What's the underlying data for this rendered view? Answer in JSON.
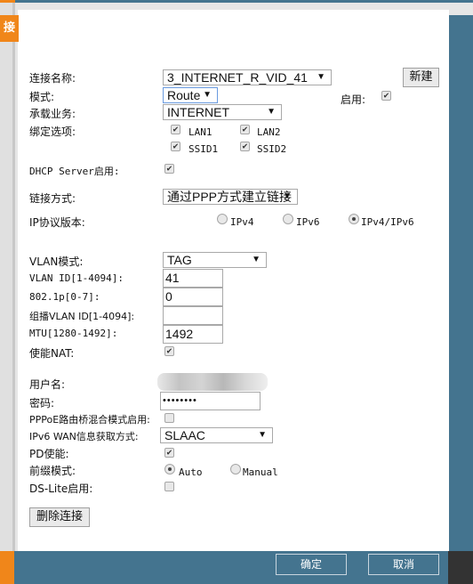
{
  "sidebar": {
    "tab_label": "接"
  },
  "form": {
    "conn_name": {
      "label": "连接名称:",
      "value": "3_INTERNET_R_VID_41"
    },
    "new_button": "新建",
    "mode": {
      "label": "模式:",
      "value": "Route"
    },
    "enable": {
      "label": "启用:",
      "checked": true
    },
    "service": {
      "label": "承载业务:",
      "value": "INTERNET"
    },
    "binding": {
      "label": "绑定选项:",
      "options": [
        {
          "label": "LAN1",
          "checked": true
        },
        {
          "label": "LAN2",
          "checked": true
        },
        {
          "label": "SSID1",
          "checked": true
        },
        {
          "label": "SSID2",
          "checked": true
        }
      ]
    },
    "dhcp": {
      "label": "DHCP Server启用:",
      "checked": true
    },
    "link_mode": {
      "label": "链接方式:",
      "value": "通过PPP方式建立链接"
    },
    "ip_version": {
      "label": "IP协议版本:",
      "options": [
        "IPv4",
        "IPv6",
        "IPv4/IPv6"
      ],
      "selected": "IPv4/IPv6"
    },
    "vlan_mode": {
      "label": "VLAN模式:",
      "value": "TAG"
    },
    "vlan_id": {
      "label": "VLAN ID[1-4094]:",
      "value": "41"
    },
    "p8021": {
      "label": "802.1p[0-7]:",
      "value": "0"
    },
    "mcast_vlan": {
      "label": "组播VLAN ID[1-4094]:",
      "value": ""
    },
    "mtu": {
      "label": "MTU[1280-1492]:",
      "value": "1492"
    },
    "nat": {
      "label": "使能NAT:",
      "checked": true
    },
    "username": {
      "label": "用户名:"
    },
    "password": {
      "label": "密码:",
      "value": "••••••••"
    },
    "pppoe_bridge": {
      "label": "PPPoE路由桥混合模式启用:",
      "checked": false
    },
    "ipv6_wan": {
      "label": "IPv6 WAN信息获取方式:",
      "value": "SLAAC"
    },
    "pd": {
      "label": "PD使能:",
      "checked": true
    },
    "prefix_mode": {
      "label": "前缀模式:",
      "options": [
        "Auto",
        "Manual"
      ],
      "selected": "Auto"
    },
    "dslite": {
      "label": "DS-Lite启用:",
      "checked": false
    },
    "delete_button": "删除连接"
  },
  "footer": {
    "ok": "确定",
    "cancel": "取消"
  },
  "colors": {
    "bar": "#44748f",
    "accent": "#f0861a"
  }
}
